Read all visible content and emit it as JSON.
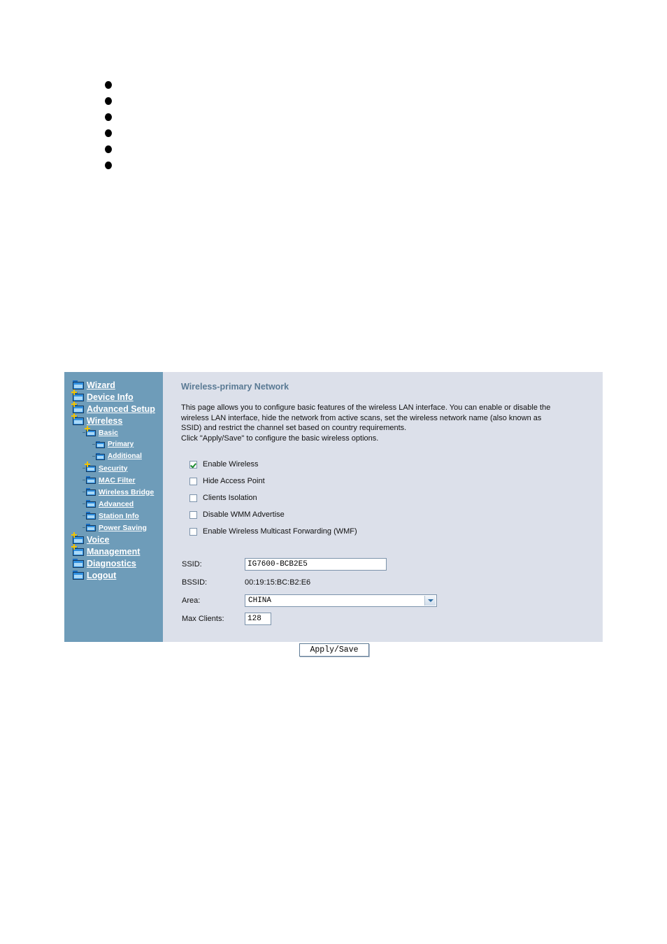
{
  "bullets": [
    {
      "marker": "bullet-dot",
      "text": ""
    },
    {
      "marker": "bullet-dot",
      "text": ""
    },
    {
      "marker": "bullet-dot",
      "text": ""
    },
    {
      "marker": "bullet-dot",
      "text": ""
    },
    {
      "marker": "bullet-dot",
      "text": ""
    },
    {
      "marker": "bullet-dot",
      "text": ""
    }
  ],
  "colors": {
    "sidebar_bg": "#6e9cb9",
    "content_bg": "#dce0ea",
    "title_text": "#5a7a94",
    "nav_link": "#ffffff",
    "folder_blue": "#2f8fe0",
    "plus_badge": "#f2c300",
    "check_green": "#1a8a2e"
  },
  "sidebar": {
    "items": [
      {
        "label": "Wizard",
        "level": 1,
        "icon": "folder-icon",
        "expandable": false
      },
      {
        "label": "Device Info",
        "level": 1,
        "icon": "folder-plus-icon",
        "expandable": true
      },
      {
        "label": "Advanced Setup",
        "level": 1,
        "icon": "folder-plus-icon",
        "expandable": true
      },
      {
        "label": "Wireless",
        "level": 1,
        "icon": "folder-plus-icon",
        "expandable": true
      },
      {
        "label": "Basic",
        "level": 2,
        "icon": "folder-plus-icon",
        "expandable": true
      },
      {
        "label": "Primary",
        "level": 3,
        "icon": "folder-icon",
        "expandable": false
      },
      {
        "label": "Additional",
        "level": 3,
        "icon": "folder-icon",
        "expandable": false
      },
      {
        "label": "Security",
        "level": 2,
        "icon": "folder-plus-icon",
        "expandable": true
      },
      {
        "label": "MAC Filter",
        "level": 2,
        "icon": "folder-icon",
        "expandable": false
      },
      {
        "label": "Wireless Bridge",
        "level": 2,
        "icon": "folder-icon",
        "expandable": false
      },
      {
        "label": "Advanced",
        "level": 2,
        "icon": "folder-icon",
        "expandable": false
      },
      {
        "label": "Station Info",
        "level": 2,
        "icon": "folder-icon",
        "expandable": false
      },
      {
        "label": "Power Saving",
        "level": 2,
        "icon": "folder-icon",
        "expandable": false
      },
      {
        "label": "Voice",
        "level": 1,
        "icon": "folder-plus-icon",
        "expandable": true
      },
      {
        "label": "Management",
        "level": 1,
        "icon": "folder-plus-icon",
        "expandable": true
      },
      {
        "label": "Diagnostics",
        "level": 1,
        "icon": "folder-icon",
        "expandable": false
      },
      {
        "label": "Logout",
        "level": 1,
        "icon": "folder-icon",
        "expandable": false
      }
    ]
  },
  "main": {
    "title": "Wireless-primary Network",
    "description_lines": [
      "This page allows you to configure basic features of the wireless LAN interface. You can enable or disable the",
      "wireless LAN interface, hide the network from active scans, set the wireless network name (also known as",
      "SSID) and restrict the channel set based on country requirements.",
      "Click \"Apply/Save\" to configure the basic wireless options."
    ],
    "checkboxes": [
      {
        "label": "Enable Wireless",
        "checked": true
      },
      {
        "label": "Hide Access Point",
        "checked": false
      },
      {
        "label": "Clients Isolation",
        "checked": false
      },
      {
        "label": "Disable WMM Advertise",
        "checked": false
      },
      {
        "label": "Enable Wireless Multicast Forwarding (WMF)",
        "checked": false
      }
    ],
    "fields": {
      "ssid_label": "SSID:",
      "ssid_value": "IG7600-BCB2E5",
      "bssid_label": "BSSID:",
      "bssid_value": "00:19:15:BC:B2:E6",
      "area_label": "Area:",
      "area_value": "CHINA",
      "max_clients_label": "Max Clients:",
      "max_clients_value": "128"
    },
    "apply_button_label": "Apply/Save"
  }
}
